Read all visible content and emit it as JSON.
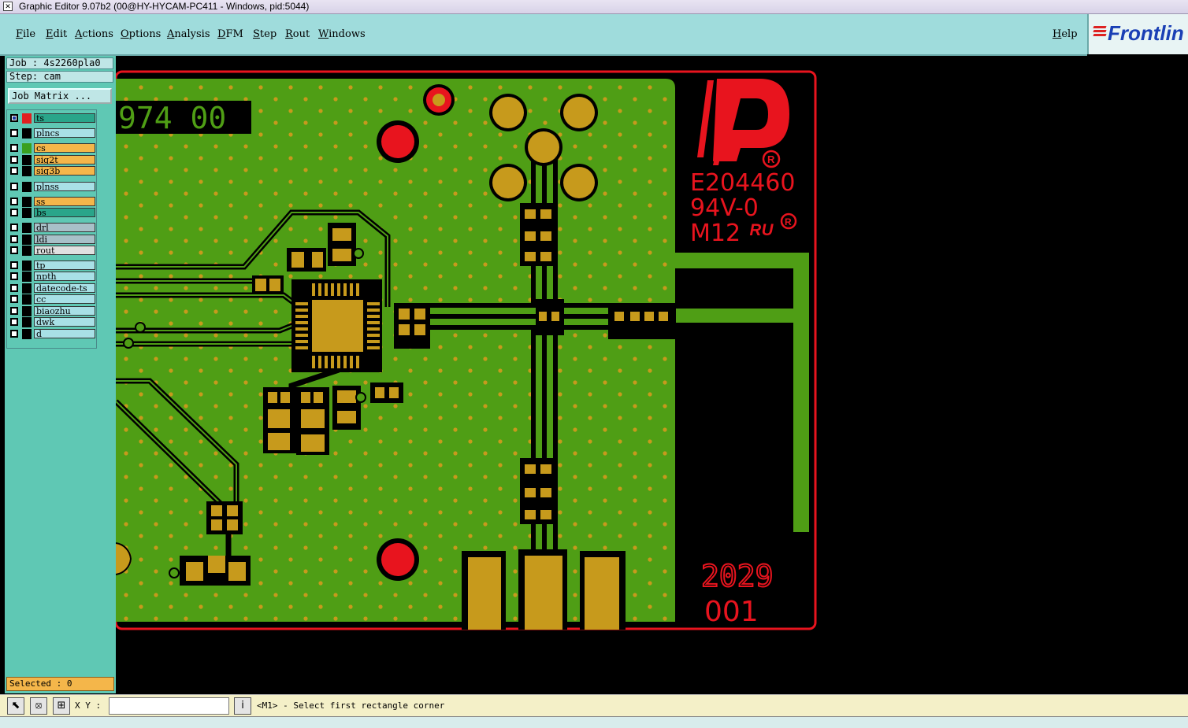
{
  "window": {
    "title": "Graphic Editor 9.07b2 (00@HY-HYCAM-PC411 - Windows, pid:5044)"
  },
  "menu": {
    "items": [
      "File",
      "Edit",
      "Actions",
      "Options",
      "Analysis",
      "DFM",
      "Step",
      "Rout",
      "Windows"
    ],
    "help": "Help"
  },
  "brand": {
    "logo": "Frontlin"
  },
  "job": {
    "job_label": "Job : 4s2260pla0",
    "step_label": "Step: cam",
    "matrix_button": "Job Matrix ..."
  },
  "layers": [
    {
      "name": "ts",
      "color": "#2aa58a",
      "swatch": "#e02020"
    },
    {
      "name": "plncs",
      "color": "#a8e0e6",
      "swatch": "#000000"
    },
    {
      "name": "cs",
      "color": "#f4b64a",
      "swatch": "#3aa020"
    },
    {
      "name": "sig2t",
      "color": "#f4b64a",
      "swatch": "#000000"
    },
    {
      "name": "sig3b",
      "color": "#f4b64a",
      "swatch": "#000000"
    },
    {
      "name": "plnss",
      "color": "#a8e0e6",
      "swatch": "#000000"
    },
    {
      "name": "ss",
      "color": "#f4b64a",
      "swatch": "#000000"
    },
    {
      "name": "bs",
      "color": "#2aa58a",
      "swatch": "#000000"
    },
    {
      "name": "drl",
      "color": "#a8c0c8",
      "swatch": "#000000"
    },
    {
      "name": "ldi",
      "color": "#a8c0c8",
      "swatch": "#000000"
    },
    {
      "name": "rout",
      "color": "#e0e0e0",
      "swatch": "#000000"
    },
    {
      "name": "tp",
      "color": "#a8e0e6",
      "swatch": "#000000"
    },
    {
      "name": "npth",
      "color": "#a8e0e6",
      "swatch": "#000000"
    },
    {
      "name": "datecode-ts",
      "color": "#a8e0e6",
      "swatch": "#000000"
    },
    {
      "name": "cc",
      "color": "#a8e0e6",
      "swatch": "#000000"
    },
    {
      "name": "biaozhu",
      "color": "#a8e0e6",
      "swatch": "#000000"
    },
    {
      "name": "dwk",
      "color": "#a8e0e6",
      "swatch": "#000000"
    },
    {
      "name": "d",
      "color": "#a8e0e6",
      "swatch": "#000000"
    }
  ],
  "selected": "Selected : 0",
  "status": {
    "xy_label": "X Y :",
    "xy_value": "",
    "prompt": "<M1> - Select first rectangle corner"
  },
  "board": {
    "part_text": "974 00",
    "ul_number": "E204460",
    "flammability": "94V-0",
    "maker_code": "M12",
    "ul_mark": "ᴿᵁ",
    "date_code": "2029",
    "serial": "001"
  },
  "colors": {
    "board_green": "#4f9e15",
    "copper": "#c79a1c",
    "silk_red": "#e8141e",
    "panel_teal": "#5fc8b4",
    "menu_teal": "#9fdcdc"
  }
}
